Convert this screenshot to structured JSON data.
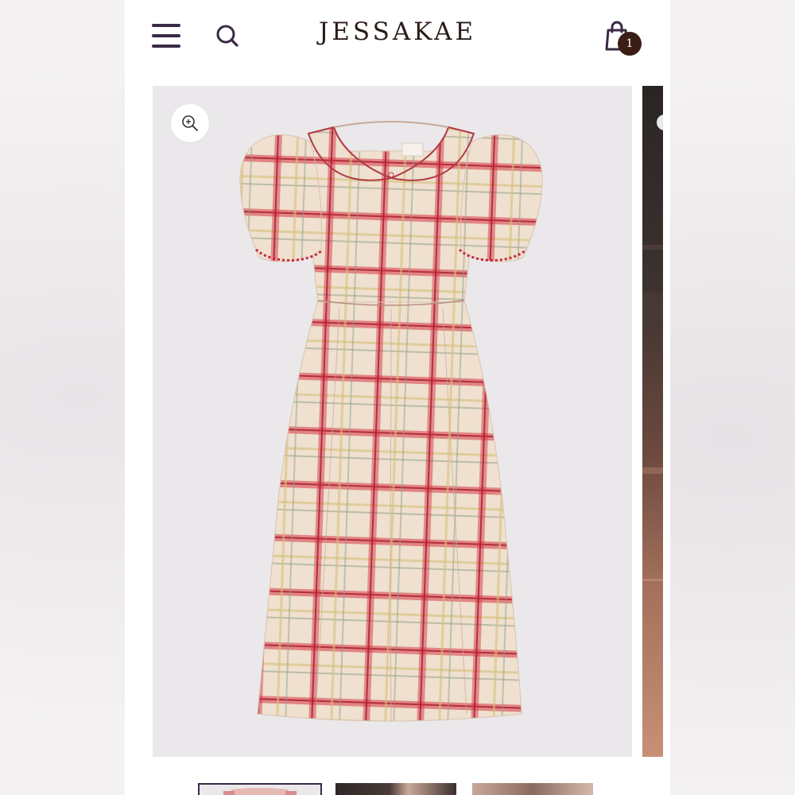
{
  "header": {
    "brand": "JESSAKAE",
    "menu_icon": "hamburger-menu-icon",
    "search_icon": "search-icon",
    "cart_icon": "shopping-bag-icon",
    "cart_count": "1"
  },
  "product_gallery": {
    "main_image": "plaid-puff-sleeve-dress-image",
    "zoom_icon": "zoom-in-icon",
    "next_slide": "model-photo-slide",
    "thumbnails": [
      "thumbnail-1",
      "thumbnail-2",
      "thumbnail-3"
    ]
  },
  "colors": {
    "brand_dark": "#2b1d18",
    "icon_purple": "#3a2a45",
    "badge": "#3a1e16",
    "image_bg": "#ebe8eb",
    "plaid_base": "#efe0cf",
    "plaid_red": "#c8283c"
  }
}
